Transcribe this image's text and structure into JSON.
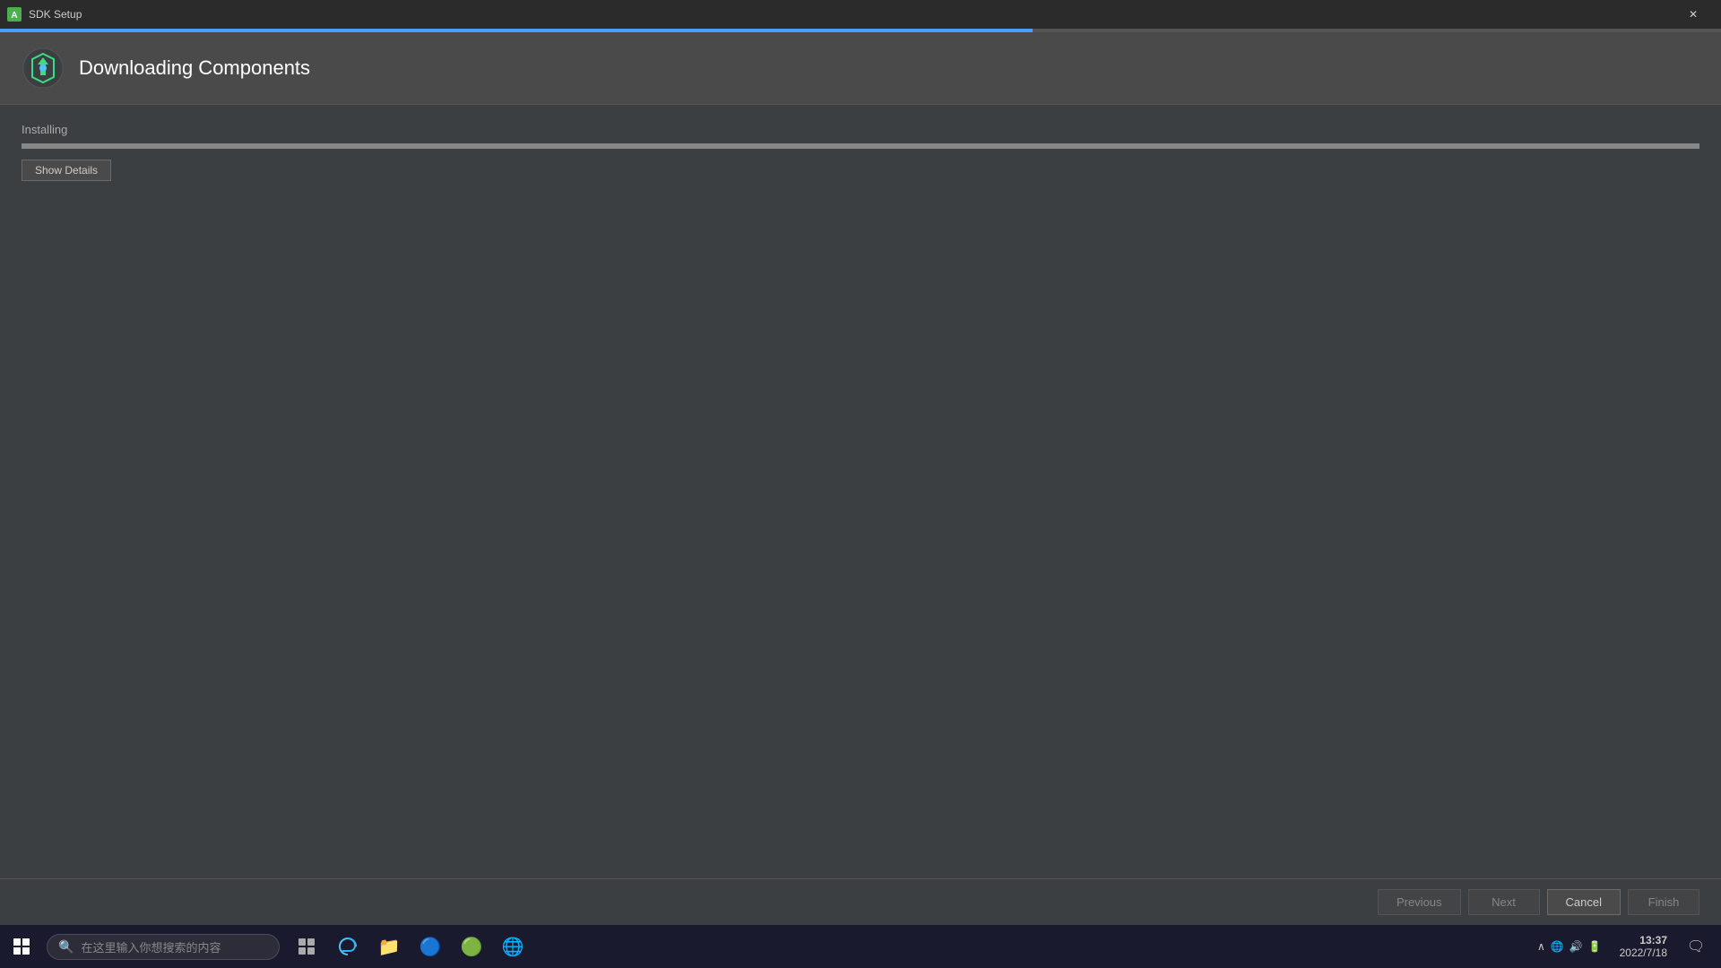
{
  "titlebar": {
    "title": "SDK Setup",
    "close_label": "✕"
  },
  "header": {
    "title": "Downloading Components"
  },
  "content": {
    "status_label": "Installing",
    "progress_percent": 100,
    "show_details_label": "Show Details"
  },
  "footer": {
    "previous_label": "Previous",
    "next_label": "Next",
    "cancel_label": "Cancel",
    "finish_label": "Finish"
  },
  "taskbar": {
    "search_placeholder": "在这里输入你想搜索的内容",
    "clock_time": "13:37",
    "clock_date": "2022/7/18",
    "system_icons": "🔔 📶 🔊"
  }
}
